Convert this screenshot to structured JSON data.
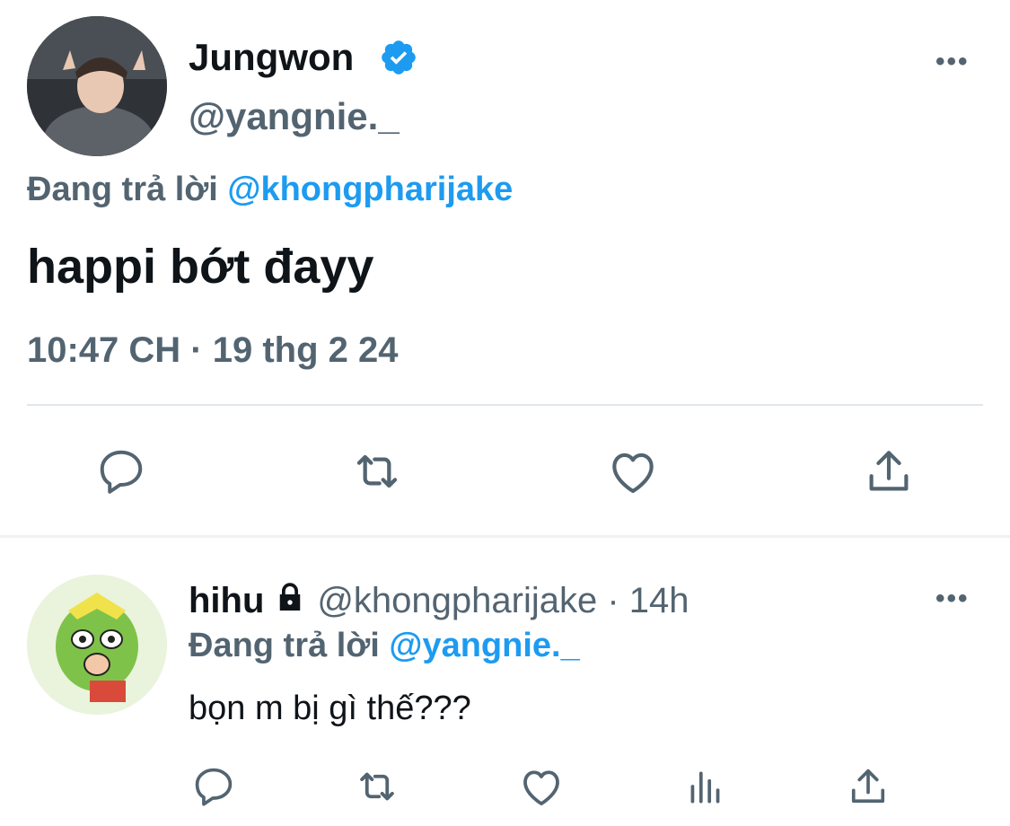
{
  "main_tweet": {
    "display_name": "Jungwon",
    "handle": "@yangnie._",
    "replying_prefix": "Đang trả lời ",
    "replying_to": "@khongpharijake",
    "text": "happi bớt đayy",
    "timestamp": "10:47 CH · 19 thg 2 24",
    "more_label": "•••"
  },
  "reply_tweet": {
    "display_name": "hihu",
    "handle": "@khongpharijake",
    "time_sep": " · ",
    "time": "14h",
    "replying_prefix": "Đang trả lời ",
    "replying_to": "@yangnie._",
    "text": "bọn m bị gì thế???",
    "more_label": "•••"
  },
  "colors": {
    "text_primary": "#0f1419",
    "text_secondary": "#536471",
    "accent": "#1d9bf0",
    "verified": "#1d9bf0"
  },
  "icons": {
    "reply": "reply-icon",
    "retweet": "retweet-icon",
    "like": "heart-icon",
    "share": "share-icon",
    "views": "analytics-icon",
    "verified": "verified-badge-icon",
    "protected": "lock-icon"
  }
}
